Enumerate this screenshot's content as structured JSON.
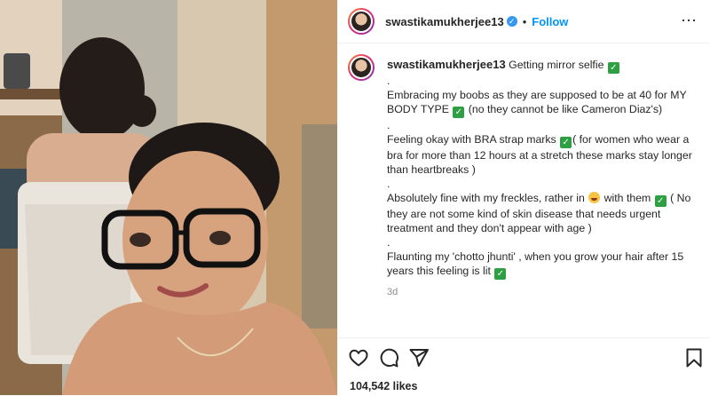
{
  "post": {
    "username": "swastikamukherjee13",
    "verified_mark": "✓",
    "dot": "•",
    "follow_label": "Follow",
    "more_label": "⋯"
  },
  "caption": {
    "username": "swastikamukherjee13",
    "lines": [
      "Getting mirror selfie",
      ".",
      "Embracing my boobs as they are supposed to be at 40 for MY BODY TYPE",
      "(no they cannot be like Cameron Diaz's)",
      ".",
      "Feeling okay with BRA strap marks",
      "( for women who wear a bra for more than 12 hours at a stretch these marks stay longer than heartbreaks )",
      ".",
      "Absolutely fine with my freckles, rather in",
      "with them",
      "( No they are not some kind of skin disease that needs urgent treatment and they don't appear with age )",
      ".",
      "Flaunting my 'chotto jhunti' , when you grow your hair after 15 years this feeling is lit"
    ],
    "timestamp": "3d",
    "check_glyph": "✓"
  },
  "footer": {
    "likes": "104,542 likes"
  },
  "icons": {
    "like": "heart-icon",
    "comment": "comment-icon",
    "share": "send-icon",
    "save": "bookmark-icon"
  }
}
